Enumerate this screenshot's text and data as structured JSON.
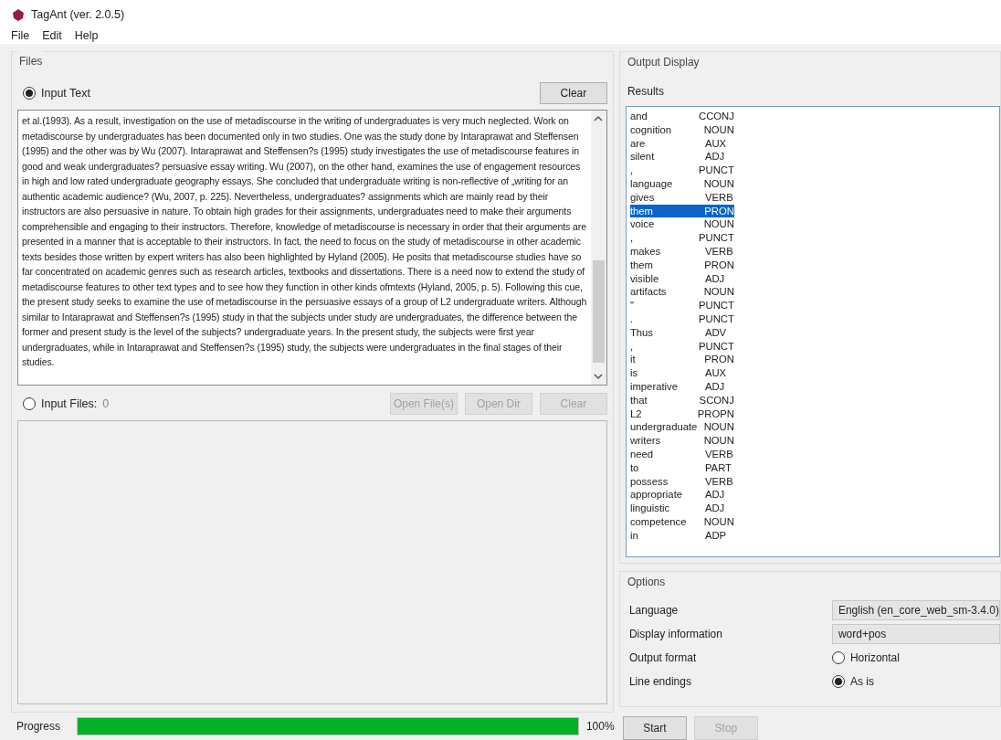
{
  "window": {
    "title": "TagAnt (ver. 2.0.5)"
  },
  "menu": [
    "File",
    "Edit",
    "Help"
  ],
  "files": {
    "title": "Files",
    "input_text": {
      "label": "Input Text",
      "selected": true,
      "clear": "Clear",
      "text": "et al.(1993). As a result, investigation on the use of metadiscourse in the writing of undergraduates is very much neglected. Work on metadiscourse by undergraduates has been documented only in two studies. One was the study done by Intaraprawat and Steffensen (1995) and the other was by Wu (2007). Intaraprawat and Steffensen?s (1995) study investigates the use of metadiscourse features in good and weak undergraduates? persuasive essay writing. Wu (2007), on the other hand, examines the use of engagement resources in high and low rated undergraduate geography essays. She concluded that undergraduate writing is non-reflective of „writing for an authentic academic audience? (Wu, 2007, p. 225). Nevertheless, undergraduates? assignments which are mainly read by their instructors are also persuasive in nature. To obtain high grades for their assignments, undergraduates need to make their arguments comprehensible and engaging to their instructors. Therefore, knowledge of metadiscourse is necessary in order that their arguments are presented in a manner that is acceptable to their instructors. In fact, the need to focus on the study of metadiscourse in other academic texts besides those written by expert writers has also been highlighted by Hyland (2005). He posits that metadiscourse studies have so far concentrated on academic genres such as research articles, textbooks and dissertations. There is a need now to extend the study of metadiscourse features to other text types and to see how they function in other kinds ofmtexts (Hyland, 2005, p. 5). Following this cue, the present study seeks to examine the use of metadiscourse in the persuasive essays of a group of L2 undergraduate writers. Although similar to Intaraprawat and Steffensen?s (1995) study in that the subjects under study are undergraduates, the difference between the former and present study is the level of the subjects? undergraduate years. In the present study, the subjects were first year undergraduates, while in Intaraprawat and Steffensen?s (1995) study, the subjects were undergraduates in the final stages of their studies."
    },
    "input_files": {
      "label": "Input Files:",
      "count": "0",
      "selected": false,
      "buttons": [
        {
          "label": "Open File(s)",
          "disabled": true
        },
        {
          "label": "Open Dir",
          "disabled": true
        },
        {
          "label": "Clear",
          "disabled": true
        }
      ]
    }
  },
  "progress": {
    "label": "Progress",
    "level": 1,
    "reading": "100%"
  },
  "output": {
    "title": "Output Display",
    "results_label": "Results",
    "rows": [
      {
        "word": "and",
        "pos": "CCONJ",
        "selected": false
      },
      {
        "word": "cognition",
        "pos": "NOUN",
        "selected": false
      },
      {
        "word": "are",
        "pos": "AUX",
        "selected": false
      },
      {
        "word": "silent",
        "pos": "ADJ",
        "selected": false
      },
      {
        "word": ",",
        "pos": "PUNCT",
        "selected": false
      },
      {
        "word": "language",
        "pos": "NOUN",
        "selected": false
      },
      {
        "word": "gives",
        "pos": "VERB",
        "selected": false
      },
      {
        "word": "them",
        "pos": "PRON",
        "selected": true
      },
      {
        "word": "voice",
        "pos": "NOUN",
        "selected": false
      },
      {
        "word": ",",
        "pos": "PUNCT",
        "selected": false
      },
      {
        "word": "makes",
        "pos": "VERB",
        "selected": false
      },
      {
        "word": "them",
        "pos": "PRON",
        "selected": false
      },
      {
        "word": "visible",
        "pos": "ADJ",
        "selected": false
      },
      {
        "word": "artifacts",
        "pos": "NOUN",
        "selected": false
      },
      {
        "word": "\"",
        "pos": "PUNCT",
        "selected": false
      },
      {
        "word": ".",
        "pos": "PUNCT",
        "selected": false
      },
      {
        "word": "Thus",
        "pos": "ADV",
        "selected": false
      },
      {
        "word": ",",
        "pos": "PUNCT",
        "selected": false
      },
      {
        "word": "it",
        "pos": "PRON",
        "selected": false
      },
      {
        "word": "is",
        "pos": "AUX",
        "selected": false
      },
      {
        "word": "imperative",
        "pos": "ADJ",
        "selected": false
      },
      {
        "word": "that",
        "pos": "SCONJ",
        "selected": false
      },
      {
        "word": "L2",
        "pos": "PROPN",
        "selected": false
      },
      {
        "word": "undergraduate",
        "pos": "NOUN",
        "selected": false
      },
      {
        "word": "writers",
        "pos": "NOUN",
        "selected": false
      },
      {
        "word": "need",
        "pos": "VERB",
        "selected": false
      },
      {
        "word": "to",
        "pos": "PART",
        "selected": false
      },
      {
        "word": "possess",
        "pos": "VERB",
        "selected": false
      },
      {
        "word": "appropriate",
        "pos": "ADJ",
        "selected": false
      },
      {
        "word": "linguistic",
        "pos": "ADJ",
        "selected": false
      },
      {
        "word": "competence",
        "pos": "NOUN",
        "selected": false
      },
      {
        "word": "in",
        "pos": "ADP",
        "selected": false
      }
    ]
  },
  "options": {
    "title": "Options",
    "items": [
      {
        "kind": "dropdown",
        "label": "Language",
        "value": "English (en_core_web_sm-3.4.0)"
      },
      {
        "kind": "dropdown",
        "label": "Display information",
        "value": "word+pos"
      },
      {
        "kind": "radio",
        "label": "Output format",
        "value": "Horizontal",
        "checked": false
      },
      {
        "kind": "radio",
        "label": "Line endings",
        "value": "As is",
        "checked": true
      }
    ]
  },
  "actions": [
    {
      "label": "Start",
      "disabled": false
    },
    {
      "label": "Stop",
      "disabled": true
    }
  ]
}
